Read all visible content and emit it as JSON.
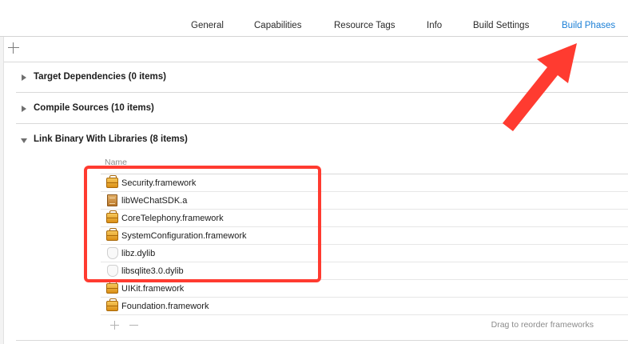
{
  "tabs": [
    {
      "label": "General",
      "active": false
    },
    {
      "label": "Capabilities",
      "active": false
    },
    {
      "label": "Resource Tags",
      "active": false
    },
    {
      "label": "Info",
      "active": false
    },
    {
      "label": "Build Settings",
      "active": false
    },
    {
      "label": "Build Phases",
      "active": true
    }
  ],
  "phases": {
    "target_dependencies": "Target Dependencies (0 items)",
    "compile_sources": "Compile Sources (10 items)",
    "link_binary": "Link Binary With Libraries (8 items)"
  },
  "libraries": {
    "column_header": "Name",
    "items": [
      {
        "name": "Security.framework",
        "icon": "framework-icon"
      },
      {
        "name": "libWeChatSDK.a",
        "icon": "static-library-icon"
      },
      {
        "name": "CoreTelephony.framework",
        "icon": "framework-icon"
      },
      {
        "name": "SystemConfiguration.framework",
        "icon": "framework-icon"
      },
      {
        "name": "libz.dylib",
        "icon": "dylib-icon"
      },
      {
        "name": "libsqlite3.0.dylib",
        "icon": "dylib-icon"
      },
      {
        "name": "UIKit.framework",
        "icon": "framework-icon"
      },
      {
        "name": "Foundation.framework",
        "icon": "framework-icon"
      }
    ],
    "reorder_hint": "Drag to reorder frameworks"
  },
  "colors": {
    "active_tab": "#1b7fd6",
    "annotation": "#ff3b30"
  }
}
